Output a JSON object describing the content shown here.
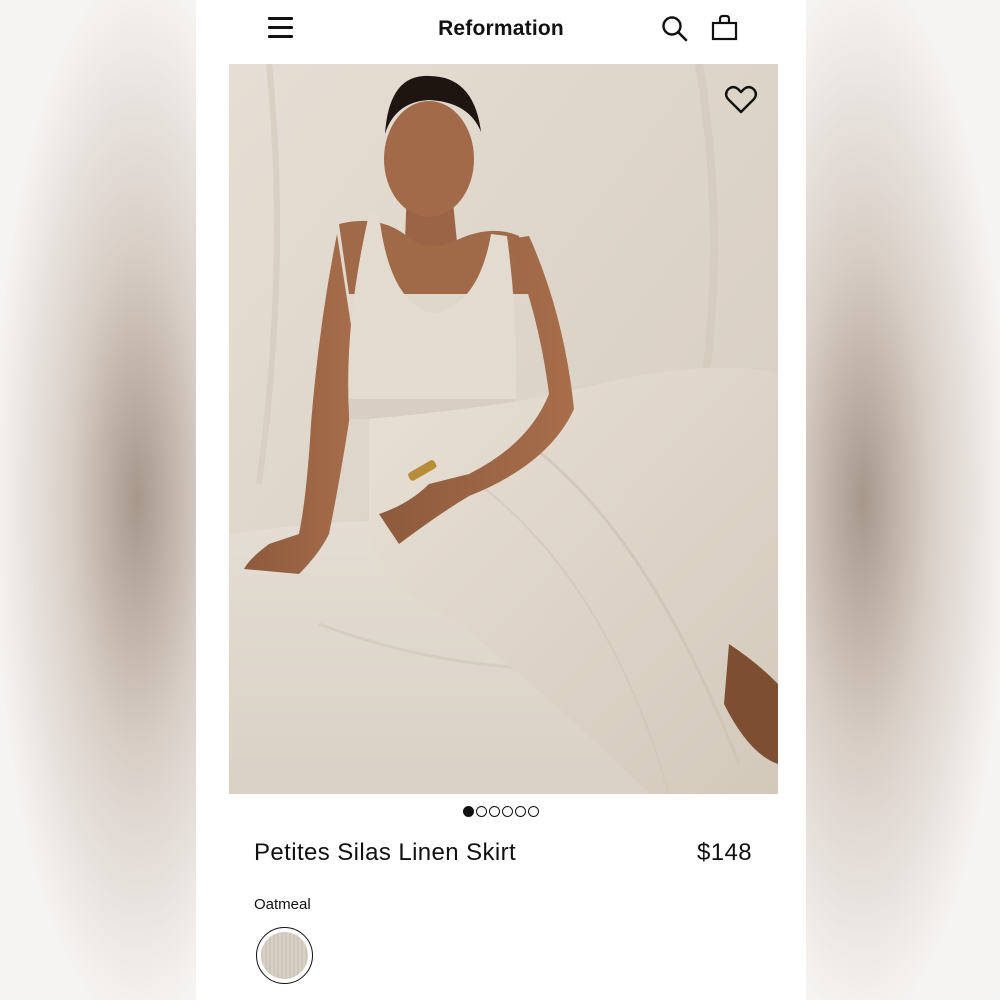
{
  "header": {
    "brand": "Reformation",
    "icons": [
      "menu-icon",
      "search-icon",
      "bag-icon"
    ]
  },
  "hero": {
    "icons": [
      "heart-icon"
    ],
    "carousel": {
      "total": 6,
      "active": 1
    }
  },
  "product": {
    "title": "Petites Silas Linen Skirt",
    "price": "$148",
    "color_name": "Oatmeal",
    "swatch_color": "#d2c9bd"
  },
  "colors": {
    "text": "#111111",
    "background": "#ffffff",
    "linen": "#e3dbd0"
  }
}
